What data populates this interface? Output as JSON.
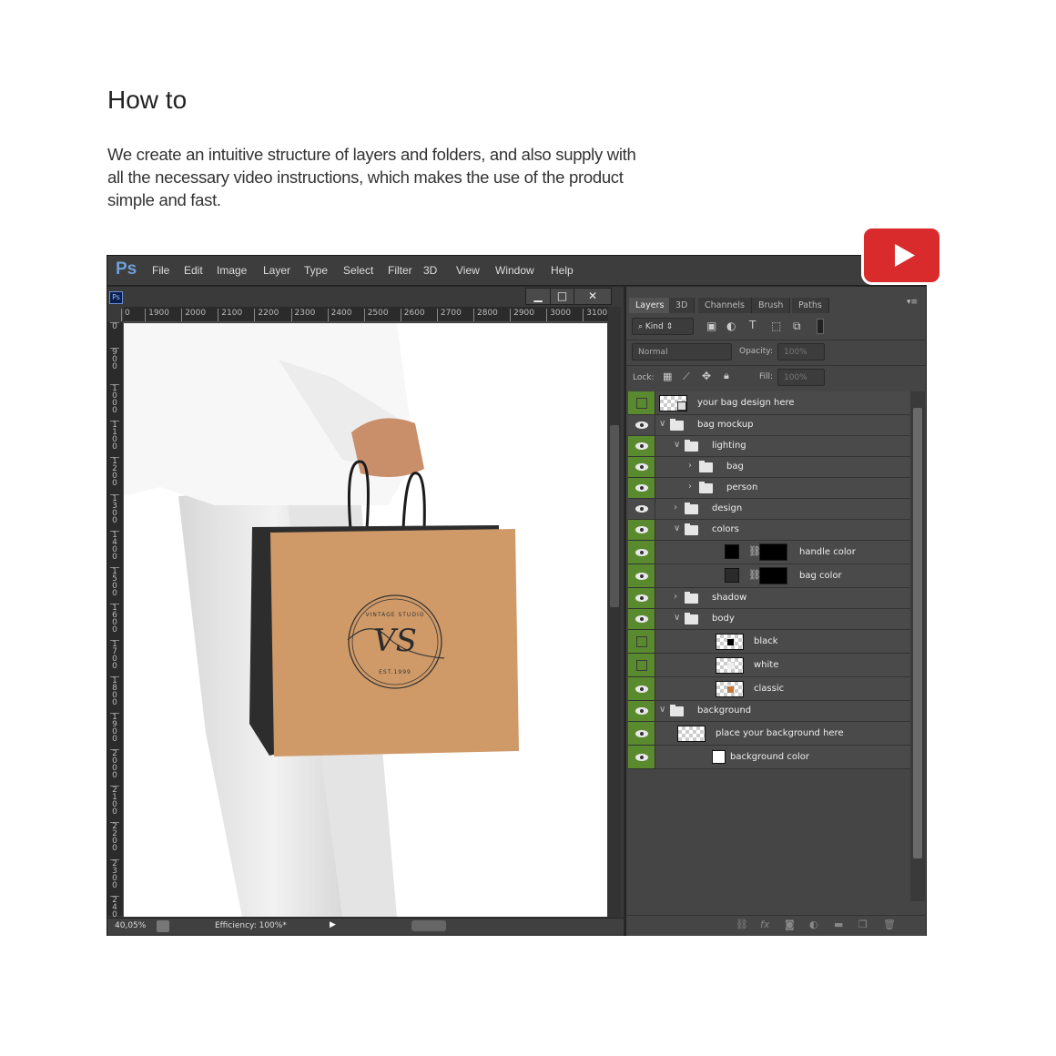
{
  "heading": "How to",
  "description": "We create an intuitive structure of layers and folders, and also supply with all the necessary video instructions, which makes the use of the product simple and fast.",
  "app": {
    "logo": "Ps",
    "menu": [
      "File",
      "Edit",
      "Image",
      "Layer",
      "Type",
      "Select",
      "Filter",
      "3D",
      "View",
      "Window",
      "Help"
    ]
  },
  "document": {
    "icon": "Ps",
    "window_buttons": {
      "minimize": "▁",
      "maximize": "□",
      "close": "✕"
    },
    "ruler_h": [
      "0",
      "1900",
      "2000",
      "2100",
      "2200",
      "2300",
      "2400",
      "2500",
      "2600",
      "2700",
      "2800",
      "2900",
      "3000",
      "3100"
    ],
    "ruler_v": [
      "0",
      "900",
      "1000",
      "1100",
      "1200",
      "1300",
      "1400",
      "1500",
      "1600",
      "1700",
      "1800",
      "1900",
      "2000",
      "2100",
      "2200",
      "2300",
      "2400"
    ],
    "zoom": "40,05%",
    "efficiency": "Efficiency: 100%*",
    "logo_text": {
      "top": "VINTAGE STUDIO",
      "monogram": "VS",
      "bottom": "EST.1999"
    }
  },
  "panel": {
    "tabs": [
      "Layers",
      "3D",
      "Channels",
      "Brush",
      "Paths"
    ],
    "active_tab": "Layers",
    "filter": "Kind",
    "blend_mode": "Normal",
    "opacity_label": "Opacity:",
    "opacity": "100%",
    "lock_label": "Lock:",
    "fill_label": "Fill:",
    "fill": "100%",
    "layers": [
      {
        "name": "your bag design here",
        "visible": false,
        "highlight": true,
        "indent": 0,
        "caret": "",
        "kind": "smart"
      },
      {
        "name": "bag mockup",
        "visible": true,
        "highlight": false,
        "indent": 0,
        "caret": "open",
        "kind": "folder"
      },
      {
        "name": "lighting",
        "visible": true,
        "highlight": true,
        "indent": 1,
        "caret": "open",
        "kind": "folder"
      },
      {
        "name": "bag",
        "visible": true,
        "highlight": true,
        "indent": 2,
        "caret": "closed",
        "kind": "folder"
      },
      {
        "name": "person",
        "visible": true,
        "highlight": true,
        "indent": 2,
        "caret": "closed",
        "kind": "folder"
      },
      {
        "name": "design",
        "visible": true,
        "highlight": false,
        "indent": 1,
        "caret": "closed",
        "kind": "folder"
      },
      {
        "name": "colors",
        "visible": true,
        "highlight": true,
        "indent": 1,
        "caret": "open",
        "kind": "folder"
      },
      {
        "name": "handle color",
        "visible": true,
        "highlight": true,
        "indent": 2,
        "caret": "",
        "kind": "fill",
        "swatch": "#000000"
      },
      {
        "name": "bag color",
        "visible": true,
        "highlight": true,
        "indent": 2,
        "caret": "",
        "kind": "fill",
        "swatch": "#2a2a2a"
      },
      {
        "name": "shadow",
        "visible": true,
        "highlight": true,
        "indent": 1,
        "caret": "closed",
        "kind": "folder"
      },
      {
        "name": "body",
        "visible": true,
        "highlight": true,
        "indent": 1,
        "caret": "open",
        "kind": "folder"
      },
      {
        "name": "black",
        "visible": false,
        "highlight": true,
        "indent": 2,
        "caret": "",
        "kind": "thumb",
        "thumb_color": "#000000"
      },
      {
        "name": "white",
        "visible": false,
        "highlight": true,
        "indent": 2,
        "caret": "",
        "kind": "thumb",
        "thumb_color": "#eeeeee"
      },
      {
        "name": "classic",
        "visible": true,
        "highlight": true,
        "indent": 2,
        "caret": "",
        "kind": "thumb",
        "thumb_color": "#c47a3e"
      },
      {
        "name": "background",
        "visible": true,
        "highlight": true,
        "indent": 0,
        "caret": "open",
        "kind": "folder"
      },
      {
        "name": "place your background here",
        "visible": true,
        "highlight": true,
        "indent": 1,
        "caret": "",
        "kind": "thumb",
        "thumb_color": ""
      },
      {
        "name": "background color",
        "visible": true,
        "highlight": true,
        "indent": 1,
        "caret": "",
        "kind": "solid",
        "swatch": "#ffffff"
      }
    ],
    "footer_icons": [
      "link-icon",
      "fx-icon",
      "mask-icon",
      "adjustment-icon",
      "folder-icon",
      "new-layer-icon",
      "trash-icon"
    ]
  },
  "colors": {
    "accent_green": "#5a8a2e",
    "youtube_red": "#d92b2b",
    "kraft": "#d09a68"
  },
  "video_icon": "youtube-play-icon"
}
